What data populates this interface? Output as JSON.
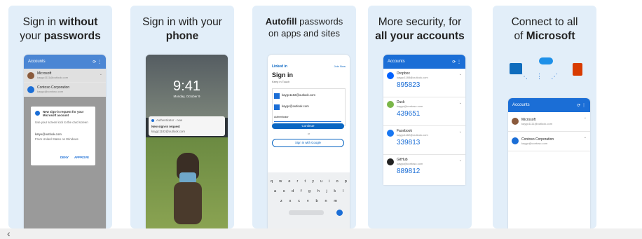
{
  "cards": [
    {
      "cap_line1": "Sign in ",
      "cap_bold1": "without",
      "cap_line2": "your ",
      "cap_bold2": "passwords",
      "header": "Accounts",
      "acct1": "Microsoft",
      "acct1_sub": "kaygc1111@outlook.com",
      "acct2": "Contoso Corporation",
      "acct2_sub": "kaygc@contoso.com",
      "dialog_title": "New sign-in request for your Microsoft account",
      "dialog_sub": "Use your screen lock to the card screen",
      "dialog_email": "katye@outlook.com",
      "dialog_loc": "From United States on Windows",
      "deny": "DENY",
      "approve": "APPROVE"
    },
    {
      "cap_line1": "Sign in with your",
      "cap_bold2": "phone",
      "time": "9:41",
      "date": "Monday, October 9",
      "notif_app": "Authenticator · now",
      "notif_title": "New sign-in request",
      "notif_sub": "kaygc1182@outlook.com"
    },
    {
      "cap_bold1": "Autofill",
      "cap_line1": " passwords",
      "cap_line2": "on apps and sites",
      "brand": "Linked in",
      "join": "Join Now",
      "title": "Sign in",
      "subtitle": "Keep in Touch",
      "acc1": "kaygc1182@outlook.com",
      "acc2": "kaygc@outlook.com",
      "pw": "Authenticator",
      "continue": "Continue",
      "or": "or",
      "google": "Sign in with Google",
      "keys_row1": [
        "q",
        "w",
        "e",
        "r",
        "t",
        "y",
        "u",
        "i",
        "o",
        "p"
      ],
      "keys_row2": [
        "a",
        "s",
        "d",
        "f",
        "g",
        "h",
        "j",
        "k",
        "l"
      ],
      "keys_row3": [
        "z",
        "x",
        "c",
        "v",
        "b",
        "n",
        "m"
      ]
    },
    {
      "cap_line1": "More security, for",
      "cap_bold2": "all your accounts",
      "header": "Accounts",
      "a1": "Dropbox",
      "a1_sub": "kaygc1188@outlook.com",
      "c1": "895823",
      "a2": "Duck",
      "a2_sub": "kaygc@contoso.com",
      "c2": "439651",
      "a3": "Facebook",
      "a3_sub": "kaygc1182@outlook.com",
      "c3": "339813",
      "a4": "GitHub",
      "a4_sub": "kaygc@contoso.com",
      "c4": "889812"
    },
    {
      "cap_line1": "Connect to all",
      "cap_line2": "of ",
      "cap_bold2": "Microsoft",
      "header": "Accounts",
      "acct1": "Microsoft",
      "acct1_sub": "kaygc1111@outlook.com",
      "acct2": "Contoso Corporation",
      "acct2_sub": "kaygc@contoso.com"
    }
  ],
  "colors": {
    "card_bg": "#e2eef9",
    "brand": "#1b6ed6"
  }
}
